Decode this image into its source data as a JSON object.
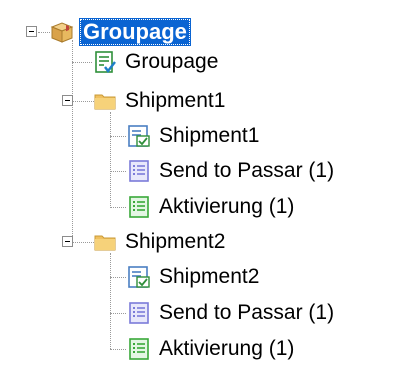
{
  "tree": {
    "root": {
      "label": "Groupage",
      "icon": "package-icon",
      "selected": true
    },
    "children": [
      {
        "label": "Groupage",
        "icon": "document-check-icon"
      },
      {
        "label": "Shipment1",
        "icon": "folder-icon",
        "expanded": true,
        "children": [
          {
            "label": "Shipment1",
            "icon": "shipment-form-icon"
          },
          {
            "label": "Send to Passar (1)",
            "icon": "list-blue-icon"
          },
          {
            "label": "Aktivierung (1)",
            "icon": "list-green-icon"
          }
        ]
      },
      {
        "label": "Shipment2",
        "icon": "folder-icon",
        "expanded": true,
        "children": [
          {
            "label": "Shipment2",
            "icon": "shipment-form-icon"
          },
          {
            "label": "Send to Passar (1)",
            "icon": "list-blue-icon"
          },
          {
            "label": "Aktivierung (1)",
            "icon": "list-green-icon"
          }
        ]
      }
    ]
  },
  "colors": {
    "selection": "#0a64d2",
    "folder": "#f0c060",
    "list_blue": "#7b7bd9",
    "list_green": "#39a839"
  }
}
